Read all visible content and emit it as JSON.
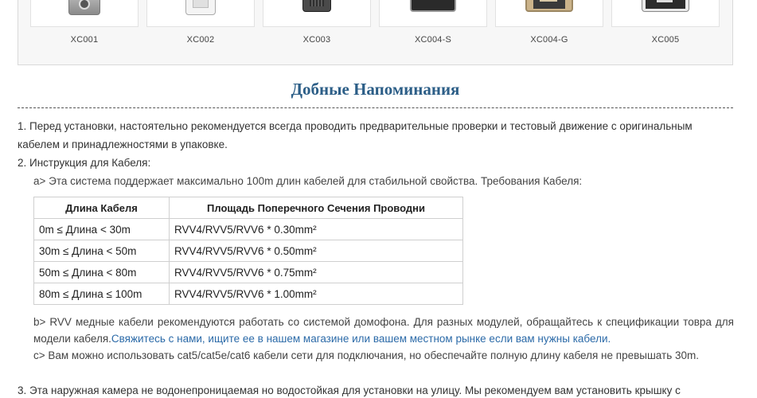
{
  "products": [
    {
      "code": "XC001",
      "icon": "intercom-silver-camera-icon"
    },
    {
      "code": "XC002",
      "icon": "intercom-white-screen-icon"
    },
    {
      "code": "XC003",
      "icon": "intercom-black-grill-icon"
    },
    {
      "code": "XC004-S",
      "icon": "intercom-black-panel-icon"
    },
    {
      "code": "XC004-G",
      "icon": "intercom-gold-panel-icon"
    },
    {
      "code": "XC005",
      "icon": "intercom-grey-panel-icon"
    }
  ],
  "section": {
    "title": "Добные Напоминания"
  },
  "content": {
    "p1": "1. Перед установки, настоятельно рекомендуется всегда проводить предварительные проверки и тестовый движение с оригинальным кабелем и принадлежностями в упаковке.",
    "p2": "2. Инструкция для Кабеля:",
    "p2a": "a> Эта система поддержает максимально 100m длин кабелей для стабильной свойства. Требования Кабеля:",
    "note_b_text": "b> RVV медные кабели рекомендуются работать со системой домофона. Для разных модулей, обращайтесь к спецификации товра для модели кабеля.",
    "note_b_link": "Свяжитесь с нами, ищите ее в нашем магазине или вашем местном рынке если вам нужны кабели.",
    "note_c": "c> Вам можно использовать cat5/cat5e/cat6 кабели сети для подключания, но обеспечайте полную длину кабеля не превышать 30m.",
    "p3": "3. Эта наружная камера не водонепроницаемая но водостойкая для установки на улицу. Мы рекомендуем вам установить крышку с"
  },
  "cable_table": {
    "headers": [
      "Длина Кабеля",
      "Площадь Поперечного Сечения Проводни"
    ],
    "rows": [
      [
        "0m ≤ Длина < 30m",
        "RVV4/RVV5/RVV6 * 0.30mm²"
      ],
      [
        "30m ≤ Длина < 50m",
        "RVV4/RVV5/RVV6 * 0.50mm²"
      ],
      [
        "50m ≤ Длина < 80m",
        "RVV4/RVV5/RVV6 * 0.75mm²"
      ],
      [
        "80m ≤ Длина ≤ 100m",
        "RVV4/RVV5/RVV6 * 1.00mm²"
      ]
    ]
  },
  "colors": {
    "title": "#2c5e87",
    "link": "#2b6aa8",
    "text": "#333333"
  }
}
